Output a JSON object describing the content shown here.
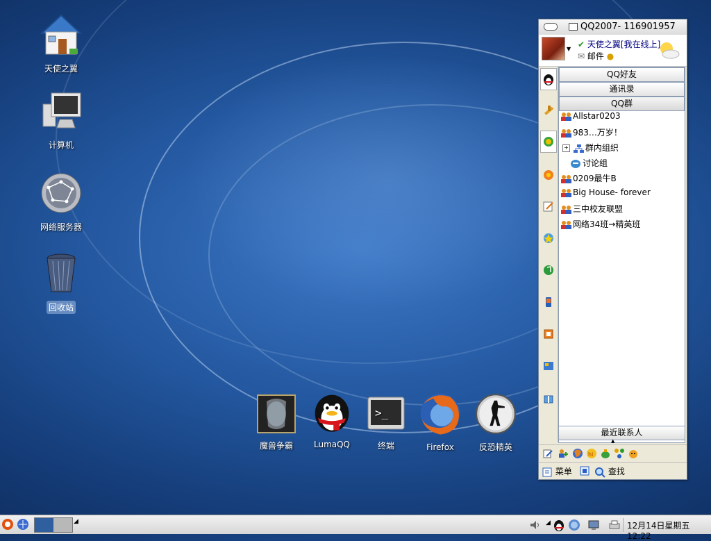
{
  "desktop": {
    "icons": [
      {
        "label": "天使之翼",
        "icon": "home-folder-icon"
      },
      {
        "label": "计算机",
        "icon": "computer-icon"
      },
      {
        "label": "网络服务器",
        "icon": "network-globe-icon"
      },
      {
        "label": "回收站",
        "icon": "trash-icon"
      }
    ]
  },
  "dock": {
    "items": [
      {
        "label": "魔兽争霸",
        "icon": "warcraft-icon"
      },
      {
        "label": "LumaQQ",
        "icon": "qq-penguin-icon"
      },
      {
        "label": "终端",
        "icon": "terminal-icon"
      },
      {
        "label": "Firefox",
        "icon": "firefox-icon"
      },
      {
        "label": "反恐精英",
        "icon": "counter-strike-icon"
      }
    ]
  },
  "qq": {
    "title": "QQ2007- 116901957",
    "user": {
      "nickname": "天使之翼[我在线上]",
      "mail_label": "邮件"
    },
    "groups": {
      "friends": "QQ好友",
      "contacts": "通讯录",
      "qq_groups": "QQ群"
    },
    "group_list": [
      "Allstar0203",
      "983…万岁！",
      "群内组织",
      "讨论组",
      "0209最牛B",
      "Big House- forever",
      "三中校友联盟",
      "网络34班→精英班"
    ],
    "recent_label": "最近联系人",
    "menu_label": "菜单",
    "find_label": "查找"
  },
  "taskbar": {
    "clock": "12月14日星期五 12:22"
  },
  "colors": {
    "desktop_blue": "#23579f",
    "window_bg": "#ece9d8",
    "nick_color": "#000080"
  }
}
